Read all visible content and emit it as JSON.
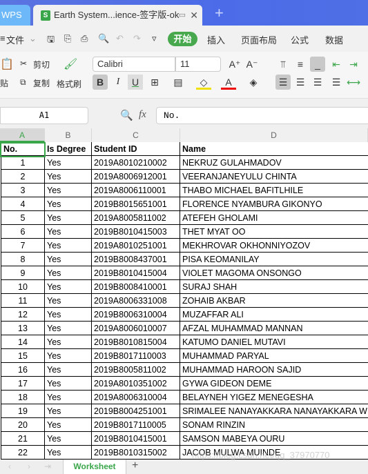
{
  "titlebar": {
    "home_tab": "WPS",
    "doc_tab": "Earth System...ience-签字版-ok",
    "new_tab": "+"
  },
  "menu": {
    "file": "文件",
    "items": [
      "开始",
      "插入",
      "页面布局",
      "公式",
      "数据"
    ]
  },
  "ribbon": {
    "cut": "剪切",
    "copy": "复制",
    "paste": "贴",
    "format_painter": "格式刷",
    "font": "Calibri",
    "size": "11",
    "bold": "B",
    "italic": "I",
    "underline": "U"
  },
  "formula": {
    "cell_ref": "A1",
    "fx": "fx",
    "value": "No."
  },
  "columns": [
    "A",
    "B",
    "C",
    "D"
  ],
  "table": {
    "headers": [
      "No.",
      "Is Degree",
      "Student ID",
      "Name"
    ],
    "rows": [
      [
        "1",
        "Yes",
        "2019A8010210002",
        "NEKRUZ GULAHMADOV"
      ],
      [
        "2",
        "Yes",
        "2019A8006912001",
        "VEERANJANEYULU CHINTA"
      ],
      [
        "3",
        "Yes",
        "2019A8006110001",
        "THABO MICHAEL BAFITLHILE"
      ],
      [
        "4",
        "Yes",
        "2019B8015651001",
        "FLORENCE NYAMBURA GIKONYO"
      ],
      [
        "5",
        "Yes",
        "2019A8005811002",
        "ATEFEH GHOLAMI"
      ],
      [
        "6",
        "Yes",
        "2019B8010415003",
        "THET MYAT OO"
      ],
      [
        "7",
        "Yes",
        "2019A8010251001",
        "MEKHROVAR OKHONNIYOZOV"
      ],
      [
        "8",
        "Yes",
        "2019B8008437001",
        "PISA KEOMANILAY"
      ],
      [
        "9",
        "Yes",
        "2019B8010415004",
        "VIOLET MAGOMA ONSONGO"
      ],
      [
        "10",
        "Yes",
        "2019B8008410001",
        "SURAJ SHAH"
      ],
      [
        "11",
        "Yes",
        "2019A8006331008",
        "ZOHAIB AKBAR"
      ],
      [
        "12",
        "Yes",
        "2019B8006310004",
        "MUZAFFAR ALI"
      ],
      [
        "13",
        "Yes",
        "2019A8006010007",
        "AFZAL MUHAMMAD MANNAN"
      ],
      [
        "14",
        "Yes",
        "2019B8010815004",
        "KATUMO DANIEL MUTAVI"
      ],
      [
        "15",
        "Yes",
        "2019B8017110003",
        "MUHAMMAD PARYAL"
      ],
      [
        "16",
        "Yes",
        "2019B8005811002",
        "MUHAMMAD HAROON SAJID"
      ],
      [
        "17",
        "Yes",
        "2019A8010351002",
        "GYWA GIDEON DEME"
      ],
      [
        "18",
        "Yes",
        "2019A8006310004",
        "BELAYNEH YIGEZ MENEGESHA"
      ],
      [
        "19",
        "Yes",
        "2019B8004251001",
        "SRIMALEE NANAYAKKARA NANAYAKKARA W"
      ],
      [
        "20",
        "Yes",
        "2019B8017110005",
        "SONAM RINZIN"
      ],
      [
        "21",
        "Yes",
        "2019B8010415001",
        "SAMSON MABEYA OURU"
      ],
      [
        "22",
        "Yes",
        "2019B8010315002",
        "JACOB MULWA MUINDE"
      ]
    ]
  },
  "sheets": {
    "active": "Worksheet",
    "add": "+"
  },
  "watermark": "https://blog.csdn.net/qq_37970770",
  "colors": {
    "accent": "#3aa64a",
    "titlebar": "#4b6be8"
  }
}
